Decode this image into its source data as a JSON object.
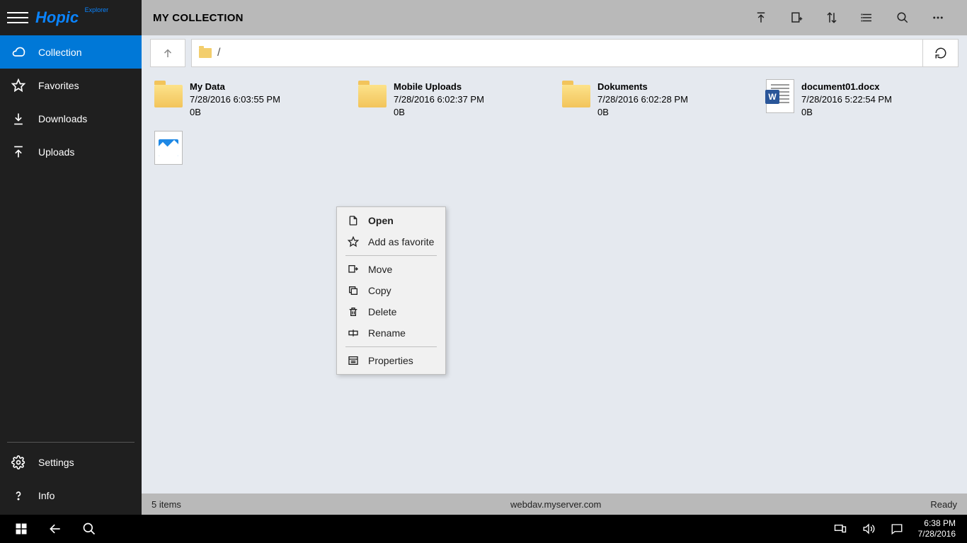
{
  "app_logo": {
    "text": "Hopic",
    "suffix": "Explorer"
  },
  "sidebar": {
    "items": [
      {
        "label": "Collection"
      },
      {
        "label": "Favorites"
      },
      {
        "label": "Downloads"
      },
      {
        "label": "Uploads"
      }
    ],
    "bottom": [
      {
        "label": "Settings"
      },
      {
        "label": "Info"
      }
    ]
  },
  "titlebar": {
    "title": "MY COLLECTION"
  },
  "path": {
    "crumb": "/"
  },
  "items": [
    {
      "name": "My Data",
      "date": "7/28/2016 6:03:55 PM",
      "size": "0B",
      "type": "folder"
    },
    {
      "name": "Mobile Uploads",
      "date": "7/28/2016 6:02:37 PM",
      "size": "0B",
      "type": "folder"
    },
    {
      "name": "Dokuments",
      "date": "7/28/2016 6:02:28 PM",
      "size": "0B",
      "type": "folder"
    },
    {
      "name": "document01.docx",
      "date": "7/28/2016 5:22:54 PM",
      "size": "0B",
      "type": "docx"
    },
    {
      "name": "",
      "date": "",
      "size": "",
      "type": "image"
    }
  ],
  "context_menu": [
    {
      "label": "Open",
      "bold": true
    },
    {
      "label": "Add as favorite"
    },
    {
      "sep": true
    },
    {
      "label": "Move"
    },
    {
      "label": "Copy"
    },
    {
      "label": "Delete"
    },
    {
      "label": "Rename"
    },
    {
      "sep": true
    },
    {
      "label": "Properties"
    }
  ],
  "status": {
    "left": "5 items",
    "center": "webdav.myserver.com",
    "right": "Ready"
  },
  "taskbar": {
    "time": "6:38 PM",
    "date": "7/28/2016"
  }
}
